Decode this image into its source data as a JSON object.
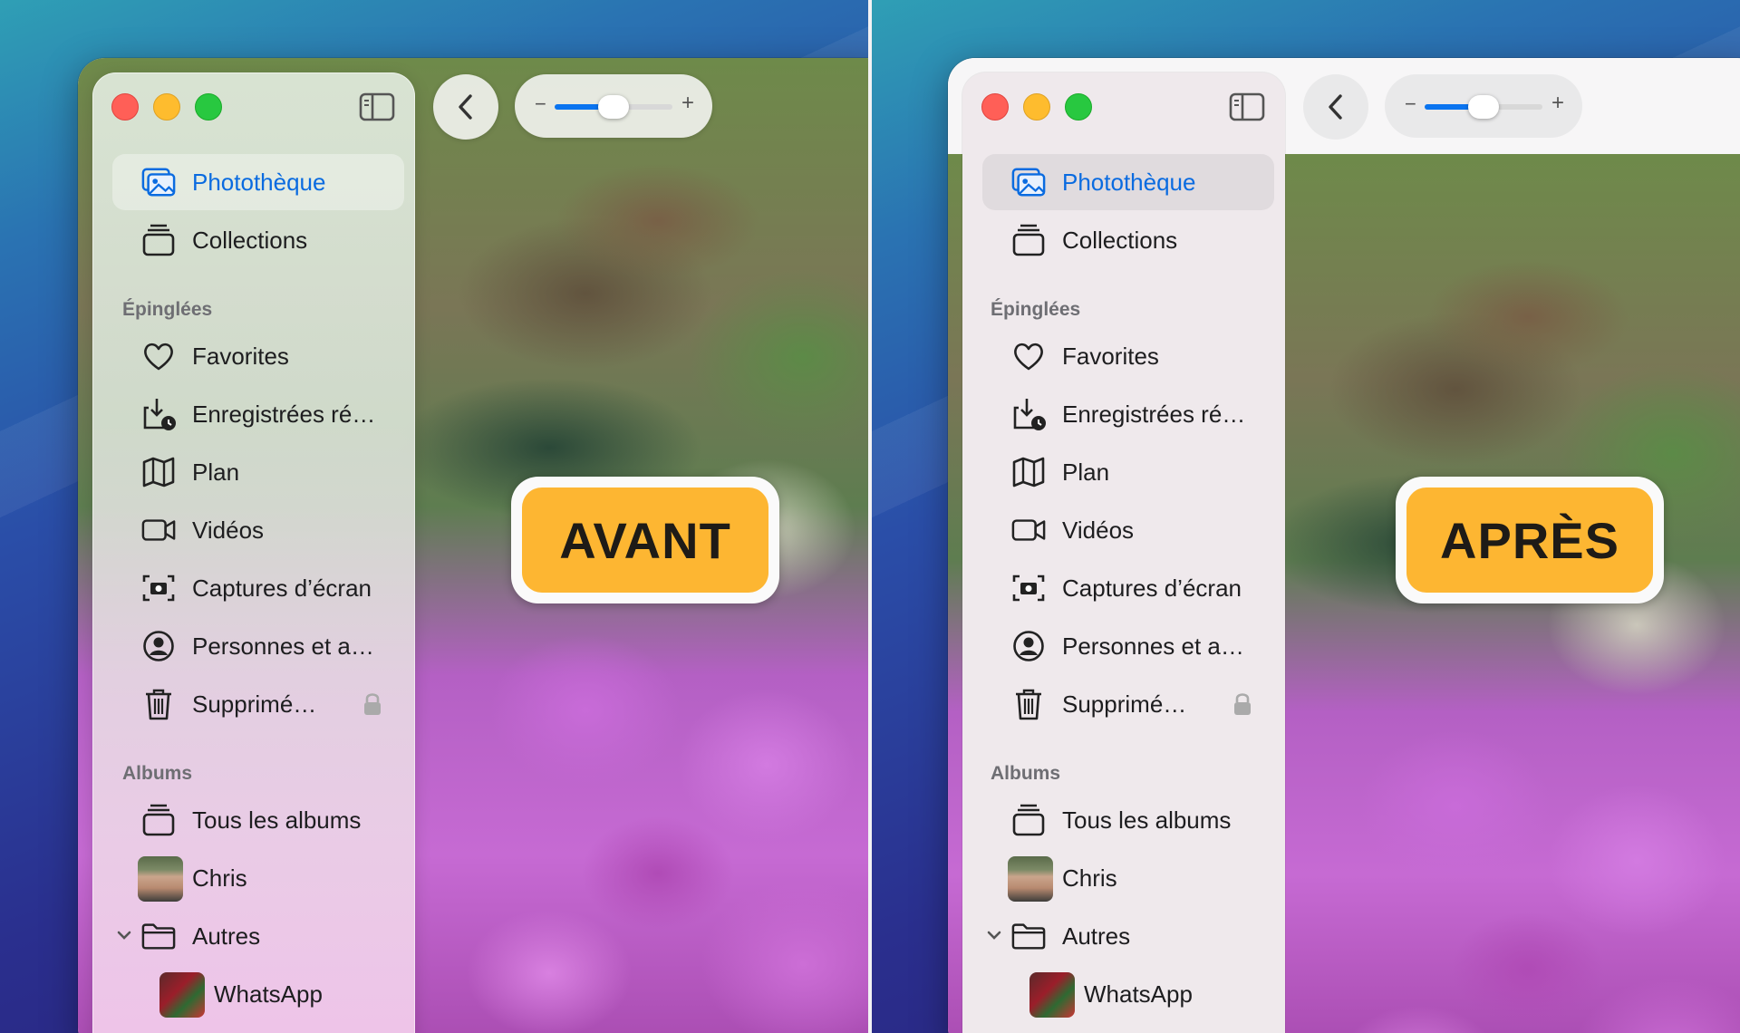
{
  "panels": [
    {
      "badge": "AVANT",
      "zoom": {
        "level": 0.5,
        "minus": "−",
        "plus": "+"
      },
      "sidebar": {
        "library": "Photothèque",
        "collections": "Collections",
        "pinned_header": "Épinglées",
        "pinned": [
          "Favorites",
          "Enregistrées ré…",
          "Plan",
          "Vidéos",
          "Captures d’écran",
          "Personnes et a…",
          "Supprimé…"
        ],
        "albums_header": "Albums",
        "albums": [
          "Tous les albums",
          "Chris",
          "Autres",
          "WhatsApp"
        ]
      }
    },
    {
      "badge": "APRÈS",
      "zoom": {
        "level": 0.5,
        "minus": "−",
        "plus": "+"
      },
      "sidebar": {
        "library": "Photothèque",
        "collections": "Collections",
        "pinned_header": "Épinglées",
        "pinned": [
          "Favorites",
          "Enregistrées ré…",
          "Plan",
          "Vidéos",
          "Captures d’écran",
          "Personnes et a…",
          "Supprimé…"
        ],
        "albums_header": "Albums",
        "albums": [
          "Tous les albums",
          "Chris",
          "Autres",
          "WhatsApp"
        ]
      }
    }
  ],
  "colors": {
    "accent": "#0a6be0",
    "badge": "#fdb632",
    "traffic_red": "#ff5f57",
    "traffic_yellow": "#febc2e",
    "traffic_green": "#28c840"
  },
  "icons": [
    "photo-library-icon",
    "collections-icon",
    "heart-icon",
    "download-clock-icon",
    "map-icon",
    "video-icon",
    "screenshot-icon",
    "person-icon",
    "trash-icon",
    "lock-icon",
    "album-stack-icon",
    "folder-icon",
    "chevron-down-icon",
    "chevron-left-icon",
    "sidebar-toggle-icon"
  ]
}
